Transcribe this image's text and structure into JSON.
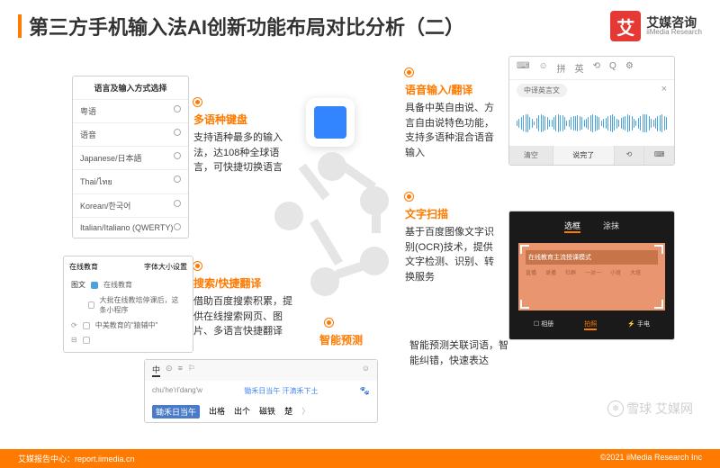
{
  "header": {
    "title": "第三方手机输入法AI创新功能布局对比分析（二）",
    "brand_cn": "艾媒咨询",
    "brand_en": "iiMedia Research",
    "brand_icon": "艾"
  },
  "features": {
    "multilang": {
      "title": "多语种键盘",
      "desc": "支持语种最多的输入法，达108种全球语言，可快捷切换语言"
    },
    "search": {
      "title": "搜索/快捷翻译",
      "desc": "借助百度搜索积累，提供在线搜索网页、图片、多语言快捷翻译"
    },
    "voice": {
      "title": "语音输入/翻译",
      "desc": "具备中英自由说、方言自由说特色功能，支持多语种混合语音输入"
    },
    "ocr": {
      "title": "文字扫描",
      "desc": "基于百度图像文字识别(OCR)技术，提供文字检测、识别、转换服务"
    },
    "smart": {
      "title": "智能预测",
      "desc": "智能预测关联词语，智能纠错，快速表达"
    }
  },
  "lang_card": {
    "header": "语言及输入方式选择",
    "items": [
      "粤语",
      "语音",
      "Japanese/日本語",
      "Thai/ไทย",
      "Korean/한국어",
      "Italian/Italiano (QWERTY)"
    ]
  },
  "search_card": {
    "tab_l": "在线教育",
    "tab_r": "字体大小设置",
    "rows": [
      "在线教育",
      "大批在线教培停课后，这条小程序",
      "中美教育的\"猿辅中\""
    ]
  },
  "voice_card": {
    "tabs": [
      "⌨",
      "☺",
      "拼",
      "英",
      "⟲",
      "Q",
      "⚙"
    ],
    "pill": "中译英言文",
    "btn_l": "清空",
    "btn_c": "说完了",
    "btn_r1": "⟲",
    "btn_r2": "⌨"
  },
  "ocr_card": {
    "tab1": "选框",
    "tab2": "涂抹",
    "header": "在线教育主流授课模式",
    "cells": [
      "直播",
      "录播",
      "社群",
      "一对一",
      "小班",
      "大班"
    ],
    "b1": "☐ 相册",
    "b2": "拍照",
    "b3": "⚡ 手电"
  },
  "pred_card": {
    "tabs": [
      "中",
      "⊙",
      "≡",
      "⚐",
      "☺"
    ],
    "pinyin": "chu'he'ri'dang'w",
    "baidu": "锄禾日当午 汗滴禾下土",
    "cands": [
      "锄禾日当午",
      "出格",
      "出个",
      "磁铁",
      "楚"
    ]
  },
  "footer": {
    "left": "艾媒报告中心：report.iimedia.cn",
    "right": "©2021 iiMedia Research Inc"
  },
  "watermark": "雪球 艾媒网"
}
